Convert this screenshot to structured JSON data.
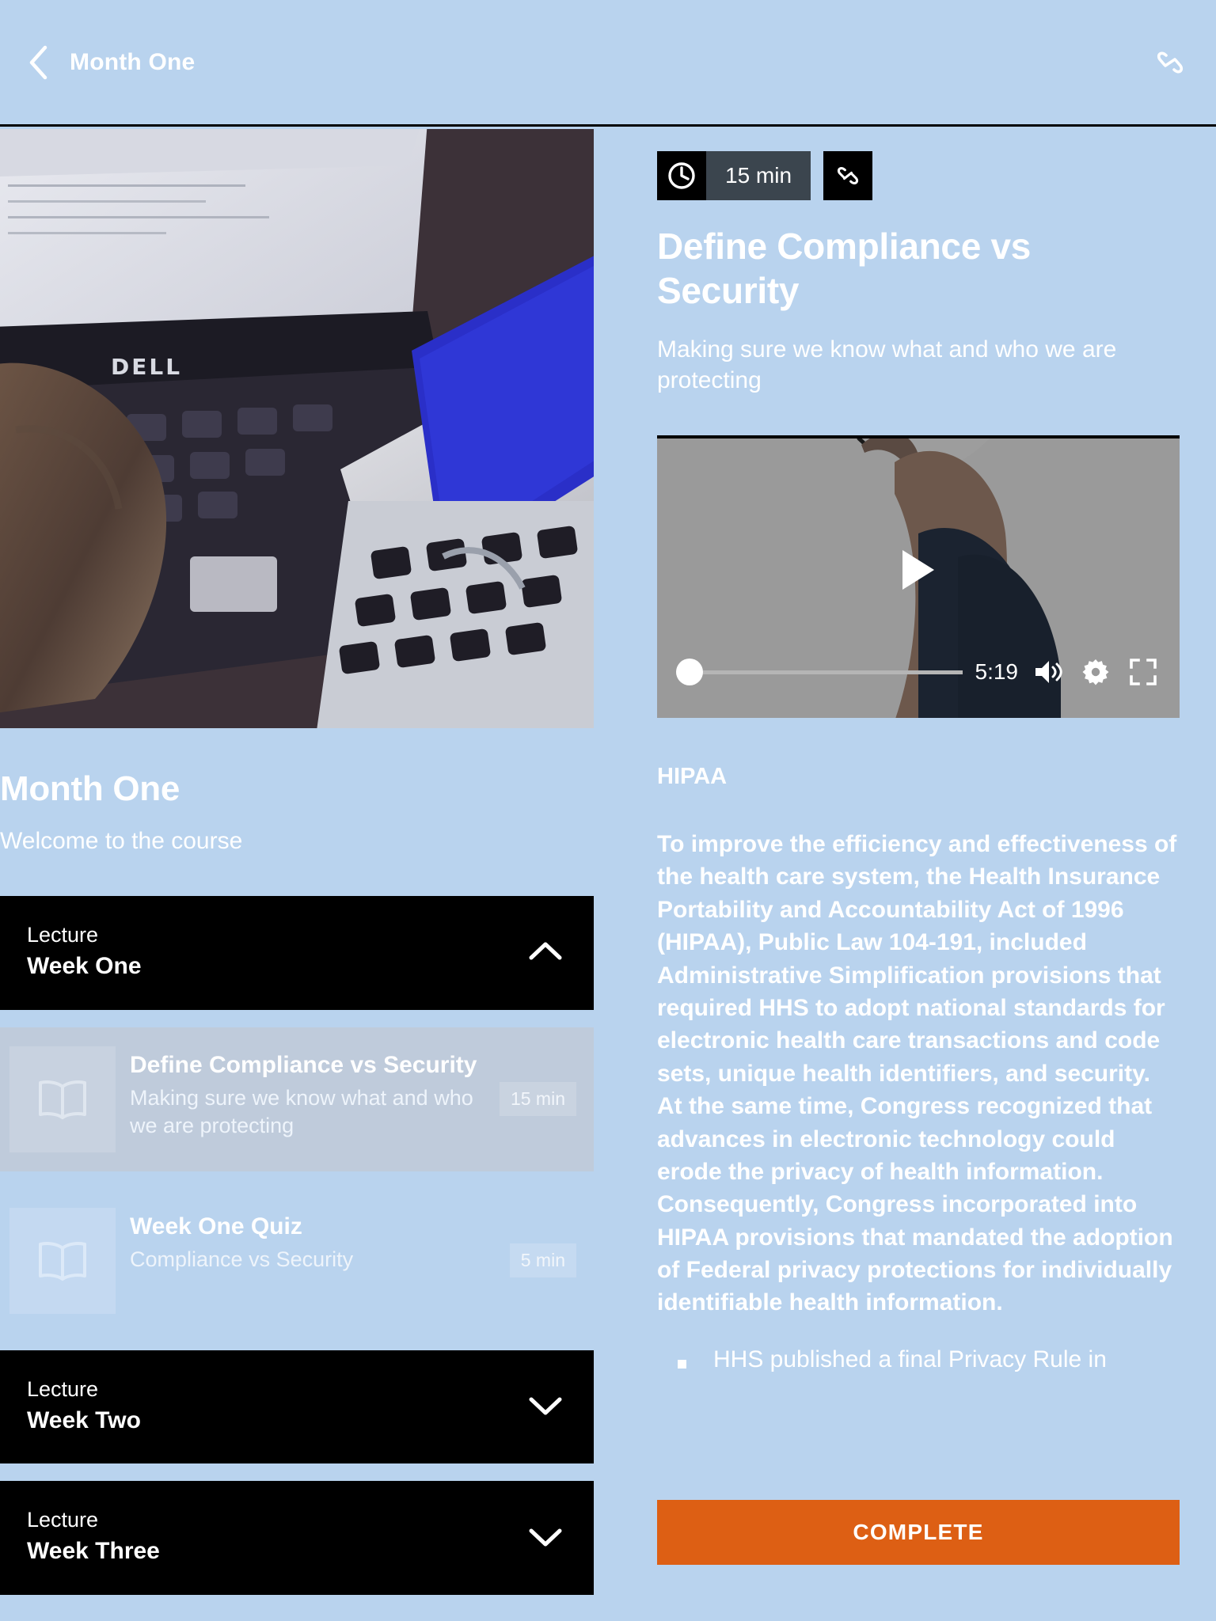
{
  "header": {
    "back_icon": "chevron-left-icon",
    "title": "Month One",
    "link_icon": "link-icon"
  },
  "hero": {
    "image_alt": "person typing on a Dell laptop next to a MacBook",
    "title": "Month One",
    "subtitle": "Welcome to the course"
  },
  "accordion": [
    {
      "eyebrow": "Lecture",
      "title": "Week One",
      "expanded": true,
      "chevron": "chevron-up-icon",
      "lessons": [
        {
          "icon": "book-icon",
          "title": "Define Compliance vs Security",
          "subtitle": "Making sure we know what and who we are protecting",
          "duration": "15 min",
          "active": true
        },
        {
          "icon": "book-icon",
          "title": "Week One Quiz",
          "subtitle": "Compliance vs Security",
          "duration": "5 min",
          "active": false
        }
      ]
    },
    {
      "eyebrow": "Lecture",
      "title": "Week Two",
      "expanded": false,
      "chevron": "chevron-down-icon",
      "lessons": []
    },
    {
      "eyebrow": "Lecture",
      "title": "Week Three",
      "expanded": false,
      "chevron": "chevron-down-icon",
      "lessons": []
    }
  ],
  "detail": {
    "duration_icon": "clock-icon",
    "duration": "15 min",
    "share_icon": "link-icon",
    "title": "Define Compliance vs Security",
    "subtitle": "Making sure we know what and who we are protecting",
    "video": {
      "play_icon": "play-icon",
      "time": "5:19",
      "volume_icon": "volume-icon",
      "settings_icon": "gear-icon",
      "fullscreen_icon": "fullscreen-icon",
      "progress_percent": 0
    },
    "section_heading": "HIPAA",
    "body": "To improve the efficiency and effectiveness of the health care system, the Health Insurance Portability and Accountability Act of 1996 (HIPAA), Public Law 104-191, included Administrative Simplification provisions that required HHS to adopt national standards for electronic health care transactions and code sets, unique health identifiers, and security. At the same time, Congress recognized that advances in electronic technology could erode the privacy of health information. Consequently, Congress incorporated into HIPAA provisions that mandated the adoption of Federal privacy protections for individually identifiable health information.",
    "bullets": [
      "HHS published a final Privacy Rule in"
    ],
    "complete_label": "COMPLETE"
  },
  "colors": {
    "background": "#b9d3ee",
    "accent_orange": "#dd5f14",
    "panel_black": "#000000",
    "chip_gray": "#3b454e",
    "active_lesson": "#bfcbdb"
  }
}
